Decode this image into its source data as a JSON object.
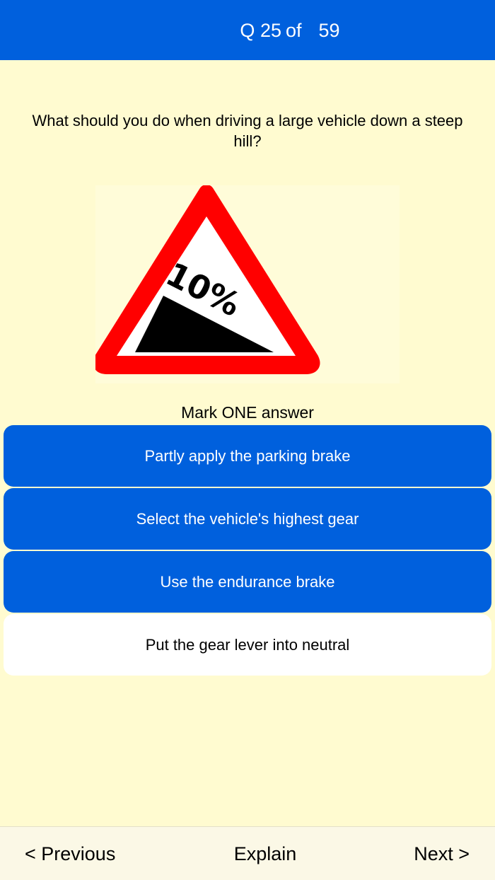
{
  "header": {
    "q_prefix": "Q",
    "current": "25",
    "of_label": "of",
    "total": "59",
    "bg_color": "#0060dd"
  },
  "question": {
    "text": "What should you do when driving a large vehicle down a steep hill?"
  },
  "sign": {
    "icon": "steep-hill-downwards-sign",
    "label": "10%"
  },
  "instruction": "Mark ONE answer",
  "answers": [
    {
      "text": "Partly apply the parking brake",
      "style": "blue"
    },
    {
      "text": "Select the vehicle's highest gear",
      "style": "blue"
    },
    {
      "text": "Use the endurance brake",
      "style": "blue"
    },
    {
      "text": "Put the gear lever into neutral",
      "style": "white"
    }
  ],
  "footer": {
    "previous": "< Previous",
    "explain": "Explain",
    "next": "Next >"
  },
  "colors": {
    "background": "#fffbd0",
    "accent": "#0060dd",
    "sign_red": "#ff0000"
  }
}
